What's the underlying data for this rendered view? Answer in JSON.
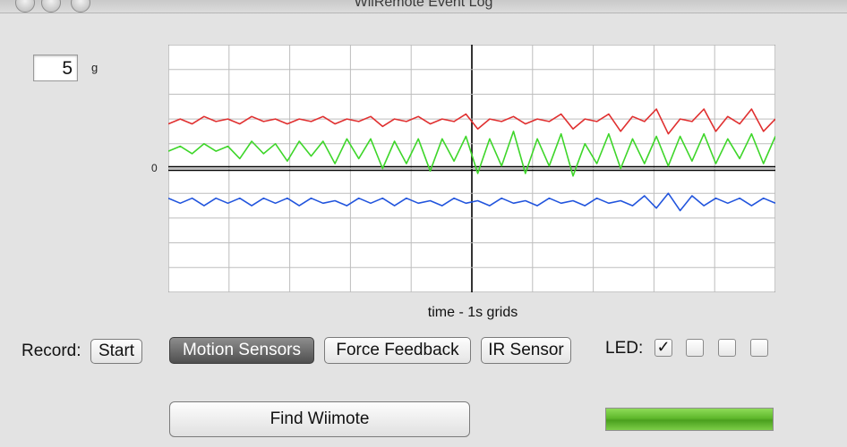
{
  "window": {
    "title": "WiiRemote Event Log"
  },
  "scale": {
    "value": "5",
    "unit": "g"
  },
  "chart": {
    "zero_label": "0",
    "xlabel": "time - 1s grids"
  },
  "record": {
    "label": "Record:",
    "start_label": "Start"
  },
  "tabs": [
    {
      "label": "Motion Sensors",
      "active": true
    },
    {
      "label": "Force Feedback",
      "active": false
    },
    {
      "label": "IR Sensor",
      "active": false
    }
  ],
  "led": {
    "label": "LED:",
    "check_mark": "✓",
    "states": [
      true,
      false,
      false,
      false
    ]
  },
  "find_button": {
    "label": "Find Wiimote"
  },
  "battery": {
    "level": 1.0
  },
  "colors": {
    "x_axis": "#e03030",
    "y_axis": "#3ed62a",
    "z_axis": "#2255dd"
  },
  "chart_data": {
    "type": "line",
    "xlabel": "time - 1s grids",
    "ylim": [
      -5,
      5
    ],
    "series": [
      {
        "values": [
          1.8,
          2.0,
          1.8,
          2.1,
          1.9,
          2.0,
          1.8,
          2.1,
          1.9,
          2.0,
          1.8,
          2.0,
          1.9,
          2.1,
          1.8,
          2.0,
          1.9,
          2.1,
          1.7,
          2.0,
          1.9,
          2.1,
          1.8,
          2.0,
          1.9,
          2.2,
          1.6,
          2.0,
          1.9,
          2.1,
          1.8,
          2.0,
          1.9,
          2.2,
          1.6,
          2.0,
          1.9,
          2.2,
          1.5,
          2.1,
          1.9,
          2.4,
          1.4,
          2.0,
          1.9,
          2.4,
          1.5,
          2.1,
          1.8,
          2.4,
          1.5,
          2.0
        ]
      },
      {
        "values": [
          0.7,
          0.9,
          0.6,
          1.0,
          0.7,
          0.9,
          0.4,
          1.1,
          0.6,
          1.0,
          0.3,
          1.1,
          0.5,
          1.1,
          0.2,
          1.2,
          0.4,
          1.2,
          0.0,
          1.1,
          0.2,
          1.2,
          -0.1,
          1.2,
          0.3,
          1.3,
          -0.2,
          1.2,
          0.1,
          1.5,
          -0.2,
          1.2,
          0.1,
          1.4,
          -0.3,
          1.0,
          0.2,
          1.4,
          0.0,
          1.2,
          0.2,
          1.3,
          0.1,
          1.3,
          0.3,
          1.4,
          0.2,
          1.2,
          0.4,
          1.4,
          0.2,
          1.3
        ]
      },
      {
        "values": [
          -1.2,
          -1.4,
          -1.2,
          -1.5,
          -1.2,
          -1.4,
          -1.2,
          -1.5,
          -1.2,
          -1.4,
          -1.2,
          -1.5,
          -1.2,
          -1.4,
          -1.3,
          -1.5,
          -1.2,
          -1.4,
          -1.2,
          -1.5,
          -1.2,
          -1.4,
          -1.3,
          -1.5,
          -1.2,
          -1.4,
          -1.3,
          -1.5,
          -1.2,
          -1.4,
          -1.3,
          -1.5,
          -1.2,
          -1.4,
          -1.3,
          -1.5,
          -1.2,
          -1.4,
          -1.3,
          -1.5,
          -1.1,
          -1.6,
          -1.0,
          -1.7,
          -1.1,
          -1.5,
          -1.2,
          -1.4,
          -1.2,
          -1.5,
          -1.2,
          -1.4
        ]
      }
    ]
  }
}
